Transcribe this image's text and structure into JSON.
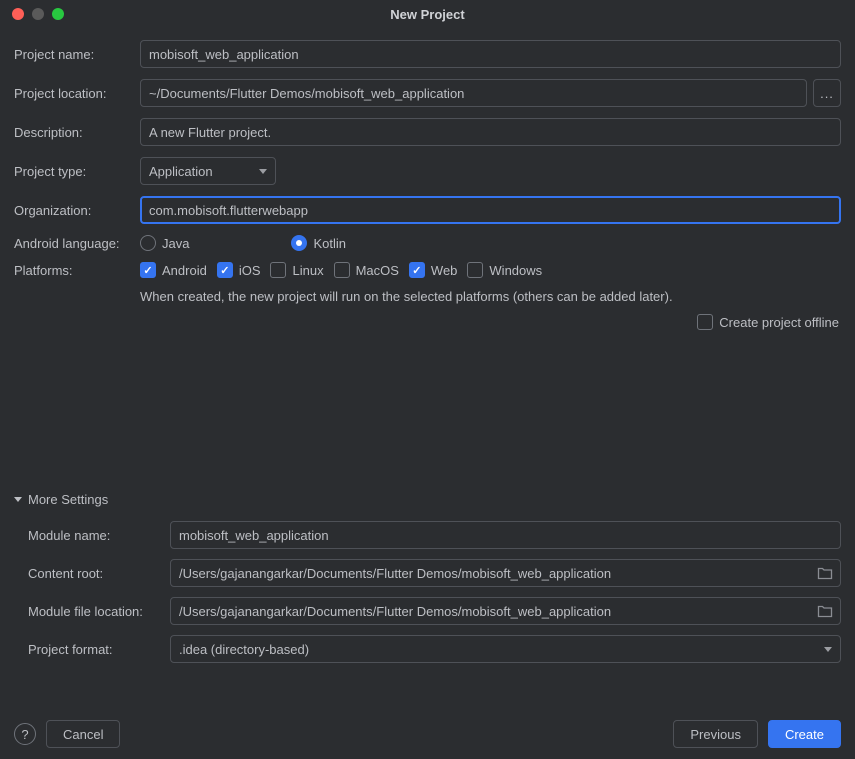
{
  "window": {
    "title": "New Project"
  },
  "fields": {
    "project_name": {
      "label": "Project name:",
      "value": "mobisoft_web_application"
    },
    "project_location": {
      "label": "Project location:",
      "value": "~/Documents/Flutter Demos/mobisoft_web_application",
      "browse": "..."
    },
    "description": {
      "label": "Description:",
      "value": "A new Flutter project."
    },
    "project_type": {
      "label": "Project type:",
      "value": "Application"
    },
    "organization": {
      "label": "Organization:",
      "value": "com.mobisoft.flutterwebapp"
    },
    "android_language": {
      "label": "Android language:",
      "options": [
        {
          "label": "Java",
          "checked": false
        },
        {
          "label": "Kotlin",
          "checked": true
        }
      ]
    },
    "platforms": {
      "label": "Platforms:",
      "options": [
        {
          "label": "Android",
          "checked": true
        },
        {
          "label": "iOS",
          "checked": true
        },
        {
          "label": "Linux",
          "checked": false
        },
        {
          "label": "MacOS",
          "checked": false
        },
        {
          "label": "Web",
          "checked": true
        },
        {
          "label": "Windows",
          "checked": false
        }
      ],
      "hint": "When created, the new project will run on the selected platforms (others can be added later)."
    },
    "create_offline": {
      "label": "Create project offline",
      "checked": false
    }
  },
  "more": {
    "title": "More Settings",
    "module_name": {
      "label": "Module name:",
      "value": "mobisoft_web_application"
    },
    "content_root": {
      "label": "Content root:",
      "value": "/Users/gajanangarkar/Documents/Flutter Demos/mobisoft_web_application"
    },
    "module_file_location": {
      "label": "Module file location:",
      "value": "/Users/gajanangarkar/Documents/Flutter Demos/mobisoft_web_application"
    },
    "project_format": {
      "label": "Project format:",
      "value": ".idea (directory-based)"
    }
  },
  "footer": {
    "help": "?",
    "cancel": "Cancel",
    "previous": "Previous",
    "create": "Create"
  }
}
